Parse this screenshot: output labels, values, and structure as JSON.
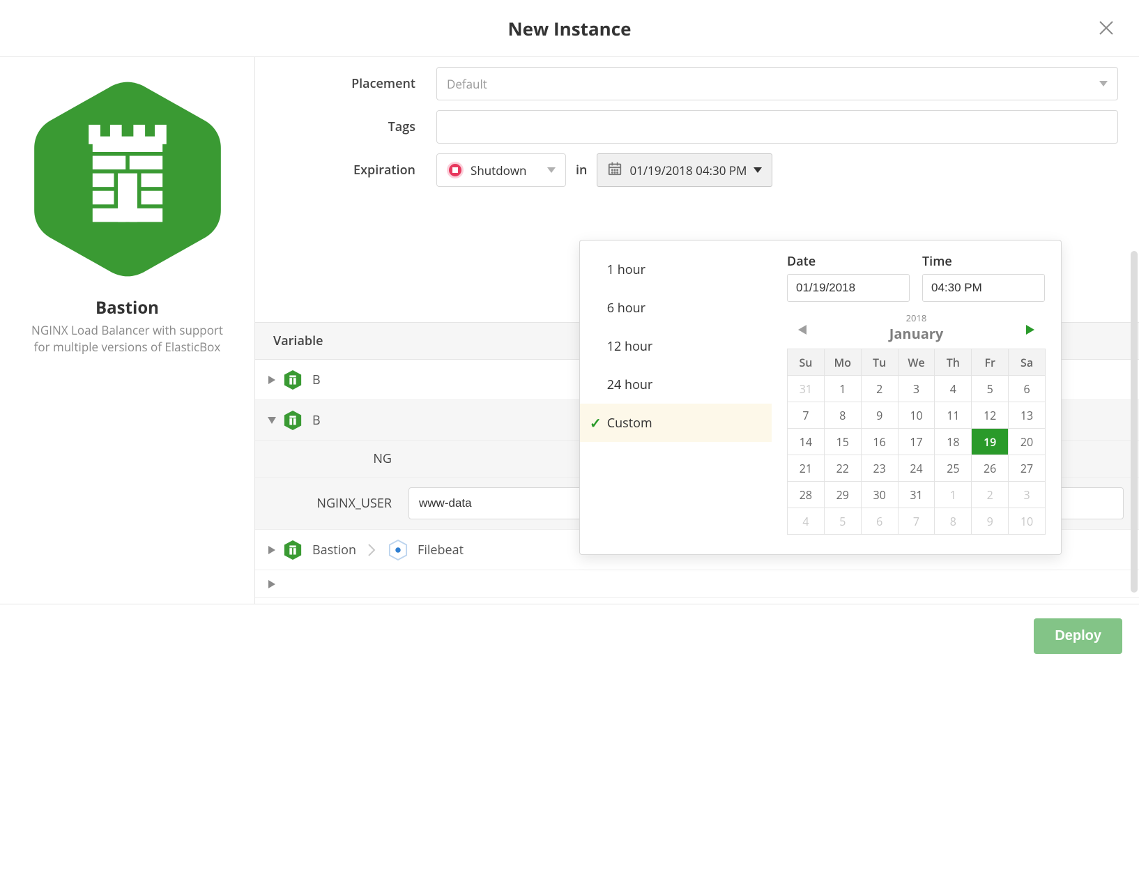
{
  "header": {
    "title": "New Instance"
  },
  "sidebar": {
    "box_title": "Bastion",
    "box_desc": "NGINX Load Balancer with support for multiple versions of ElasticBox"
  },
  "form": {
    "placement_label": "Placement",
    "placement_value": "Default",
    "tags_label": "Tags",
    "expiration_label": "Expiration",
    "shutdown_label": "Shutdown",
    "in_text": "in",
    "datetime_btn": "01/19/2018 04:30 PM"
  },
  "sections": {
    "variables": "Variable"
  },
  "tree": {
    "row1": "B",
    "row2": "B",
    "var_ng": "NG",
    "nginx_user_label": "NGINX_USER",
    "nginx_user_value": "www-data",
    "bastion": "Bastion",
    "filebeat": "Filebeat"
  },
  "popover": {
    "options": [
      "1 hour",
      "6 hour",
      "12 hour",
      "24 hour",
      "Custom"
    ],
    "selected_index": 4,
    "date_label": "Date",
    "time_label": "Time",
    "date_value": "01/19/2018",
    "time_value": "04:30 PM",
    "calendar": {
      "year": "2018",
      "month": "January",
      "dow": [
        "Su",
        "Mo",
        "Tu",
        "We",
        "Th",
        "Fr",
        "Sa"
      ],
      "weeks": [
        [
          {
            "d": "31",
            "m": true
          },
          {
            "d": "1"
          },
          {
            "d": "2"
          },
          {
            "d": "3"
          },
          {
            "d": "4"
          },
          {
            "d": "5"
          },
          {
            "d": "6"
          }
        ],
        [
          {
            "d": "7"
          },
          {
            "d": "8"
          },
          {
            "d": "9"
          },
          {
            "d": "10"
          },
          {
            "d": "11"
          },
          {
            "d": "12"
          },
          {
            "d": "13"
          }
        ],
        [
          {
            "d": "14"
          },
          {
            "d": "15"
          },
          {
            "d": "16"
          },
          {
            "d": "17"
          },
          {
            "d": "18"
          },
          {
            "d": "19",
            "s": true
          },
          {
            "d": "20"
          }
        ],
        [
          {
            "d": "21"
          },
          {
            "d": "22"
          },
          {
            "d": "23"
          },
          {
            "d": "24"
          },
          {
            "d": "25"
          },
          {
            "d": "26"
          },
          {
            "d": "27"
          }
        ],
        [
          {
            "d": "28"
          },
          {
            "d": "29"
          },
          {
            "d": "30"
          },
          {
            "d": "31"
          },
          {
            "d": "1",
            "m": true
          },
          {
            "d": "2",
            "m": true
          },
          {
            "d": "3",
            "m": true
          }
        ],
        [
          {
            "d": "4",
            "m": true
          },
          {
            "d": "5",
            "m": true
          },
          {
            "d": "6",
            "m": true
          },
          {
            "d": "7",
            "m": true
          },
          {
            "d": "8",
            "m": true
          },
          {
            "d": "9",
            "m": true
          },
          {
            "d": "10",
            "m": true
          }
        ]
      ]
    }
  },
  "footer": {
    "deploy": "Deploy"
  }
}
